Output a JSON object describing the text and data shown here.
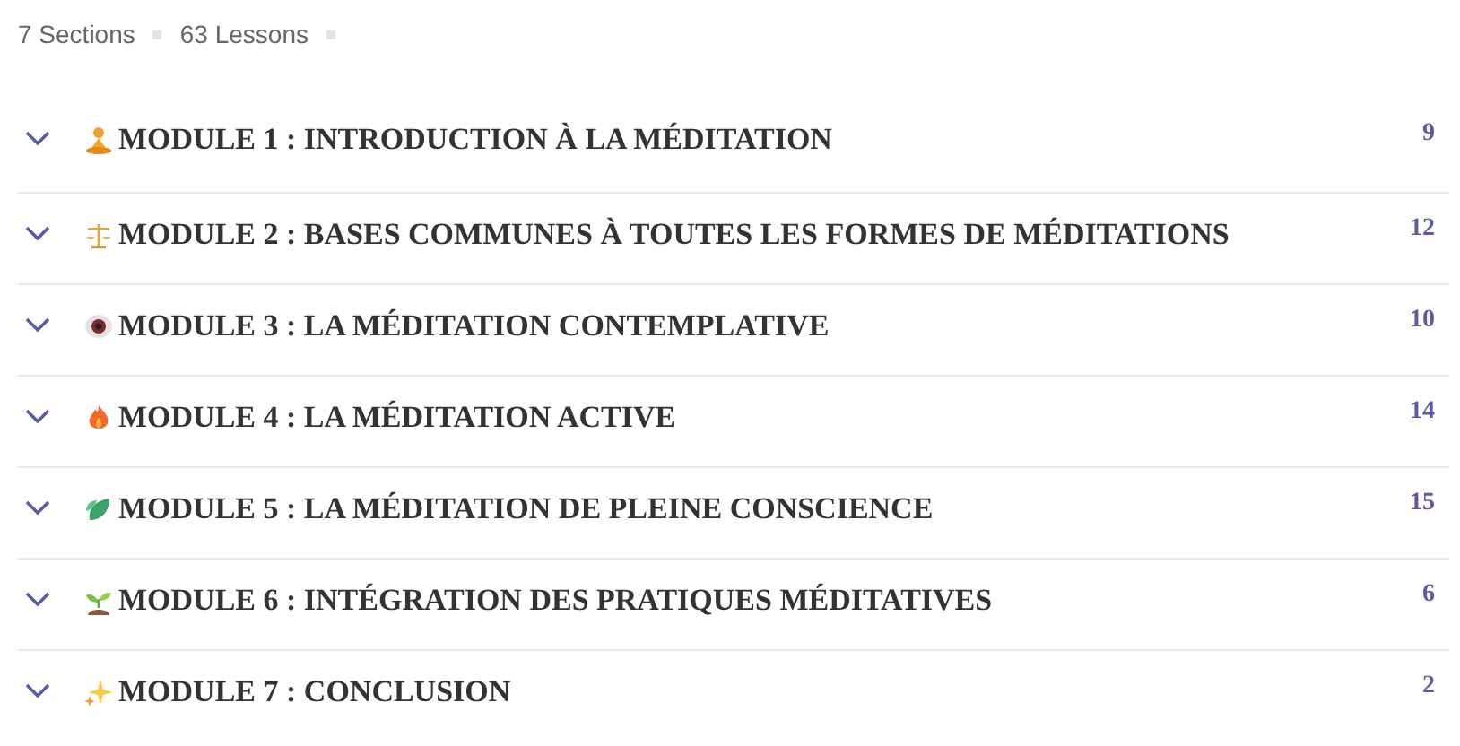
{
  "summary": {
    "sections": "7 Sections",
    "lessons": "63 Lessons"
  },
  "modules": [
    {
      "title": "MODULE 1 : INTRODUCTION À LA MÉDITATION",
      "count": "9",
      "expanded": false
    },
    {
      "title": "MODULE 2 : BASES COMMUNES À TOUTES LES FORMES DE MÉDITATIONS",
      "count": "12",
      "expanded": false
    },
    {
      "title": "MODULE 3 : LA MÉDITATION CONTEMPLATIVE",
      "count": "10",
      "expanded": false
    },
    {
      "title": "MODULE 4 : LA MÉDITATION ACTIVE",
      "count": "14",
      "expanded": false
    },
    {
      "title": "MODULE 5 : LA MÉDITATION DE PLEINE CONSCIENCE",
      "count": "15",
      "expanded": false
    },
    {
      "title": "MODULE 6 : INTÉGRATION DES PRATIQUES MÉDITATIVES",
      "count": "6",
      "expanded": false
    },
    {
      "title": "MODULE 7 : CONCLUSION",
      "count": "2",
      "expanded": false
    }
  ]
}
